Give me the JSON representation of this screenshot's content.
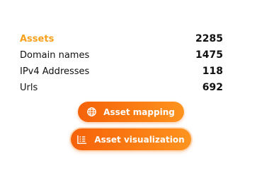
{
  "stats": [
    {
      "label": "Assets",
      "value": "2285"
    },
    {
      "label": "Domain names",
      "value": "1475"
    },
    {
      "label": "IPv4 Addresses",
      "value": "118"
    },
    {
      "label": "Urls",
      "value": "692"
    }
  ],
  "buttons": {
    "asset_mapping": {
      "label": "Asset mapping",
      "icon": "globe-icon"
    },
    "asset_visualization": {
      "label": "Asset visualization",
      "icon": "list-icon"
    }
  },
  "colors": {
    "accent": "#f7a01c",
    "button_start": "#f5620a",
    "button_end": "#fd9420",
    "text": "#111111"
  }
}
